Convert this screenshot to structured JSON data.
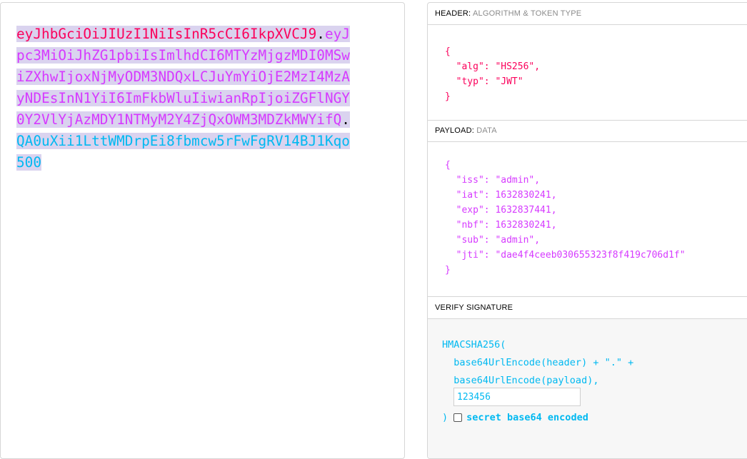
{
  "encoded": {
    "header_part": "eyJhbGciOiJIUzI1NiIsInR5cCI6IkpXVCJ9",
    "dot": ".",
    "payload_part": "eyJpc3MiOiJhZG1pbiIsImlhdCI6MTYzMjgzMDI0MSwiZXhwIjoxNjMyODM3NDQxLCJuYmYiOjE2MzI4MzAyNDEsInN1YiI6ImFkbWluIiwianRpIjoiZGFlNGY0Y2VlYjAzMDY1NTMyM2Y4ZjQxOWM3MDZkMWYifQ",
    "signature_part": "QA0uXii1LttWMDrpEi8fbmcw5rFwFgRV14BJ1Kqo500"
  },
  "header_section": {
    "title": "HEADER:",
    "subtitle": "ALGORITHM & TOKEN TYPE",
    "lines": [
      "{",
      "  \"alg\": \"HS256\",",
      "  \"typ\": \"JWT\"",
      "}"
    ]
  },
  "payload_section": {
    "title": "PAYLOAD:",
    "subtitle": "DATA",
    "lines": [
      "{",
      "  \"iss\": \"admin\",",
      "  \"iat\": 1632830241,",
      "  \"exp\": 1632837441,",
      "  \"nbf\": 1632830241,",
      "  \"sub\": \"admin\",",
      "  \"jti\": \"dae4f4ceeb030655323f8f419c706d1f\"",
      "}"
    ]
  },
  "verify_section": {
    "title": "VERIFY SIGNATURE",
    "fn_open": "HMACSHA256(",
    "line1": "  base64UrlEncode(header) + \".\" +",
    "line2": "  base64UrlEncode(payload),",
    "secret_value": "123456",
    "fn_close": ")",
    "checkbox_label": "secret base64 encoded",
    "checkbox_checked": false
  },
  "colors": {
    "header": "#fb015b",
    "payload": "#d63aff",
    "signature": "#00b9f1",
    "highlight": "#dad3ef"
  }
}
